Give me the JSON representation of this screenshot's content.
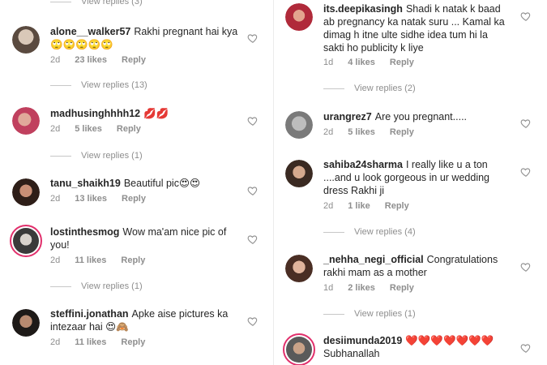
{
  "left": {
    "top_view_replies": "View replies (3)",
    "comments": [
      {
        "username": "alone__walker57",
        "text": "Rakhi pregnant hai kya",
        "emoji": "🙄🙄🙄🙄🙄",
        "time": "2d",
        "likes": "23 likes",
        "reply": "Reply",
        "view_replies": "View replies (13)"
      },
      {
        "username": "madhusinghhhh12",
        "text": "",
        "emoji": "💋💋",
        "time": "2d",
        "likes": "5 likes",
        "reply": "Reply",
        "view_replies": "View replies (1)"
      },
      {
        "username": "tanu_shaikh19",
        "text": "Beautiful pic",
        "emoji": "😍😍",
        "time": "2d",
        "likes": "13 likes",
        "reply": "Reply",
        "view_replies": ""
      },
      {
        "username": "lostinthesmog",
        "text": "Wow ma'am nice pic of you!",
        "emoji": "",
        "time": "2d",
        "likes": "11 likes",
        "reply": "Reply",
        "view_replies": "View replies (1)"
      },
      {
        "username": "steffini.jonathan",
        "text": "Apke aise pictures ka intezaar hai",
        "emoji": "😍🙈",
        "time": "2d",
        "likes": "11 likes",
        "reply": "Reply",
        "view_replies": ""
      }
    ]
  },
  "right": {
    "comments": [
      {
        "username": "its.deepikasingh",
        "text": "Shadi k natak k baad ab pregnancy ka natak suru ... Kamal ka dimag h itne ulte sidhe idea tum hi la sakti ho publicity k liye",
        "emoji": "",
        "time": "1d",
        "likes": "4 likes",
        "reply": "Reply",
        "view_replies": "View replies (2)"
      },
      {
        "username": "urangrez7",
        "text": "Are you pregnant.....",
        "emoji": "",
        "time": "2d",
        "likes": "5 likes",
        "reply": "Reply",
        "view_replies": ""
      },
      {
        "username": "sahiba24sharma",
        "text": "I really like u a ton ....and u look gorgeous in ur wedding dress Rakhi ji",
        "emoji": "",
        "time": "2d",
        "likes": "1 like",
        "reply": "Reply",
        "view_replies": "View replies (4)"
      },
      {
        "username": "_nehha_negi_official",
        "text": "Congratulations rakhi mam  as a mother",
        "emoji": "",
        "time": "1d",
        "likes": "2 likes",
        "reply": "Reply",
        "view_replies": "View replies (1)"
      },
      {
        "username": "desiimunda2019",
        "text": "",
        "emoji": "❤️❤️❤️❤️❤️❤️❤️",
        "text2": "Subhanallah",
        "time": "",
        "likes": "",
        "reply": "",
        "view_replies": ""
      }
    ]
  },
  "colors": {
    "text": "#262626",
    "muted": "#8e8e8e",
    "story_ring": "#e1306c",
    "line": "#c7c7c7"
  },
  "icons": {
    "like": "heart-outline-icon"
  }
}
